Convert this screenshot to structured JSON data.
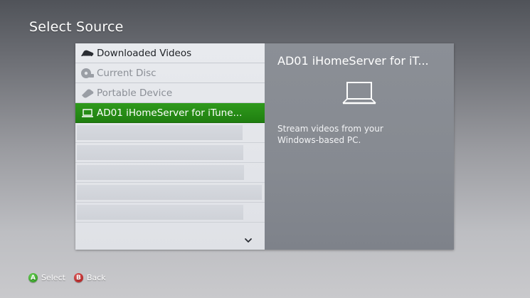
{
  "page": {
    "title": "Select Source"
  },
  "list": {
    "items": [
      {
        "label": "Downloaded Videos",
        "icon": "download-icon",
        "state": "active"
      },
      {
        "label": "Current Disc",
        "icon": "disc-icon",
        "state": "disabled"
      },
      {
        "label": "Portable Device",
        "icon": "portable-device-icon",
        "state": "disabled"
      },
      {
        "label": "AD01 iHomeServer for iTune...",
        "icon": "laptop-icon",
        "state": "selected"
      }
    ],
    "scroll_icon": "chevron-down-icon"
  },
  "details": {
    "title": "AD01 iHomeServer for iT...",
    "icon": "laptop-icon",
    "description": "Stream videos from your Windows-based PC."
  },
  "footer": {
    "a_glyph": "A",
    "a_label": "Select",
    "b_glyph": "B",
    "b_label": "Back"
  },
  "colors": {
    "selection_green": "#1f7e10",
    "button_a": "#3aa12a",
    "button_b": "#b62a2a"
  }
}
